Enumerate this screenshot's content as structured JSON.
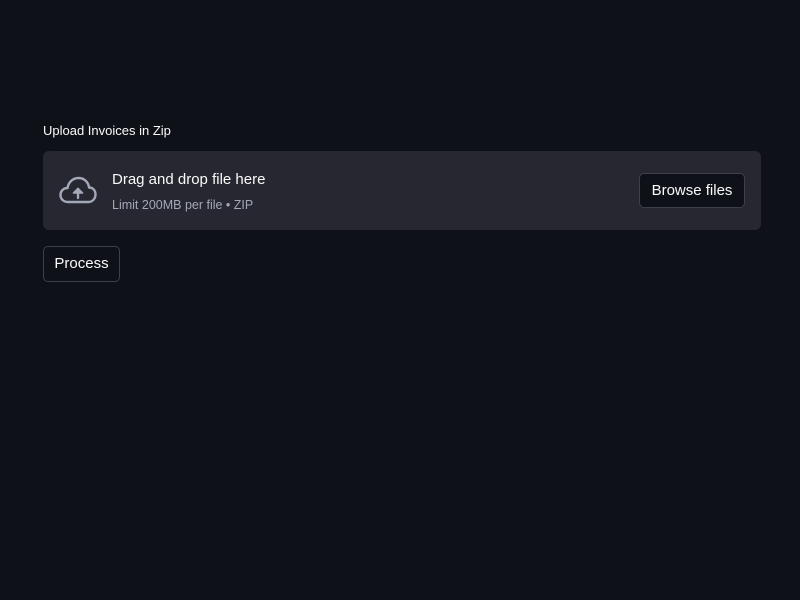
{
  "uploader": {
    "label": "Upload Invoices in Zip",
    "dropzone_title": "Drag and drop file here",
    "dropzone_limit": "Limit 200MB per file • ZIP",
    "browse_label": "Browse files",
    "icon": "cloud-upload-icon"
  },
  "actions": {
    "process_label": "Process"
  },
  "colors": {
    "background": "#0e1117",
    "dropzone_background": "#262730",
    "text": "#fafafa",
    "muted_text": "#a3a8b8",
    "button_border": "#3d3f4b"
  }
}
